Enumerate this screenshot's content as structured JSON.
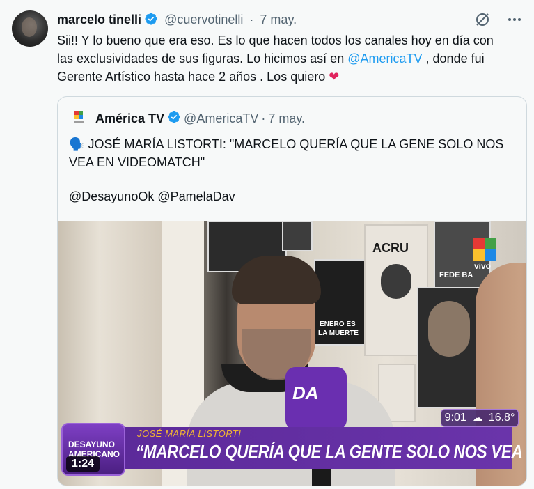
{
  "author": {
    "name": "marcelo tinelli",
    "handle": "@cuervotinelli",
    "separator": "·",
    "date": "7 may."
  },
  "tweet": {
    "line1": "Sii!! Y lo bueno que era eso. Es lo que hacen todos los canales hoy en día con",
    "line2": "las exclusividades de sus figuras. Lo hicimos así en",
    "mention": "@AmericaTV",
    "line2_end": " , donde fui",
    "line3": "Gerente Artístico hasta hace 2 años . Los quiero",
    "heart": "❤"
  },
  "icons": {
    "top_right": [
      "slash-circle-icon",
      "more-icon"
    ],
    "verified": "verified-badge-icon"
  },
  "colors": {
    "link": "#1d9bf0",
    "verified": "#1d9bf0",
    "heart": "#e0245e",
    "chyron": "#6a34aa",
    "chyron_name": "#f2b633"
  },
  "quote": {
    "name": "América TV",
    "handle": "@AmericaTV",
    "separator": "·",
    "date": "7 may.",
    "emoji": "🗣️",
    "text_line1": "JOSÉ MARÍA LISTORTI: \"MARCELO QUERÍA QUE LA GENE SOLO NOS",
    "text_line2": "VEA EN VIDEOMATCH\"",
    "mentions": "@DesayunoOk @PamelaDav"
  },
  "video": {
    "poster_acru": "ACRU",
    "poster_enero": "ENERO ES",
    "poster_muerte": "LA MUERTE",
    "poster_fede": "FEDE BA",
    "mic_logo": "DA",
    "vivo": "vivo",
    "program_line1": "DESAYUNO",
    "program_line2": "AMERICANO",
    "chyron_name": "JOSÉ MARÍA LISTORTI",
    "chyron_quote": "“MARCELO QUERÍA QUE LA GENTE SOLO NOS VEA EN VIDEOMATCH”",
    "clock": "9:01",
    "temperature": "16.8°",
    "duration": "1:24"
  }
}
